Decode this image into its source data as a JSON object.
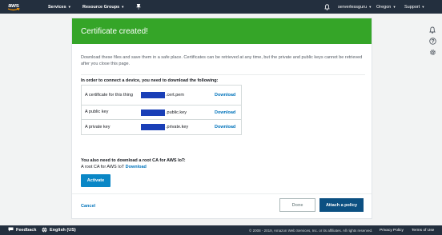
{
  "nav": {
    "logo_text": "aws",
    "services": "Services",
    "resource_groups": "Resource Groups",
    "account": "serverlessguru",
    "region": "Oregon",
    "support": "Support"
  },
  "banner": {
    "title": "Certificate created!"
  },
  "intro": "Download these files and save them in a safe place. Certificates can be retrieved at any time, but the private and public keys cannot be retrieved after you close this page.",
  "requirement_heading": "In order to connect a device, you need to download the following:",
  "files": [
    {
      "label": "A certificate for this thing",
      "filename": ".cert.pem",
      "action": "Download"
    },
    {
      "label": "A public key",
      "filename": ".public.key",
      "action": "Download"
    },
    {
      "label": "A private key",
      "filename": ".private.key",
      "action": "Download"
    }
  ],
  "root_ca": {
    "heading": "You also need to download a root CA for AWS IoT:",
    "text": "A root CA for AWS IoT",
    "link": "Download"
  },
  "buttons": {
    "activate": "Activate",
    "cancel": "Cancel",
    "done": "Done",
    "attach_policy": "Attach a policy"
  },
  "footer": {
    "feedback": "Feedback",
    "language": "English (US)",
    "copyright": "© 2008 - 2019, Amazon Web Services, Inc. or its affiliates. All rights reserved.",
    "privacy": "Privacy Policy",
    "terms": "Terms of Use"
  },
  "colors": {
    "nav_bg": "#232f3e",
    "banner_green": "#35a528",
    "link_blue": "#0073bb",
    "primary_button": "#0c5082",
    "activate_button": "#0a87c6",
    "redaction": "#1a3fb7"
  },
  "icons": [
    "aws-logo-icon",
    "pin-icon",
    "bell-icon",
    "notification-icon",
    "help-icon",
    "settings-icon",
    "feedback-icon",
    "globe-icon"
  ]
}
